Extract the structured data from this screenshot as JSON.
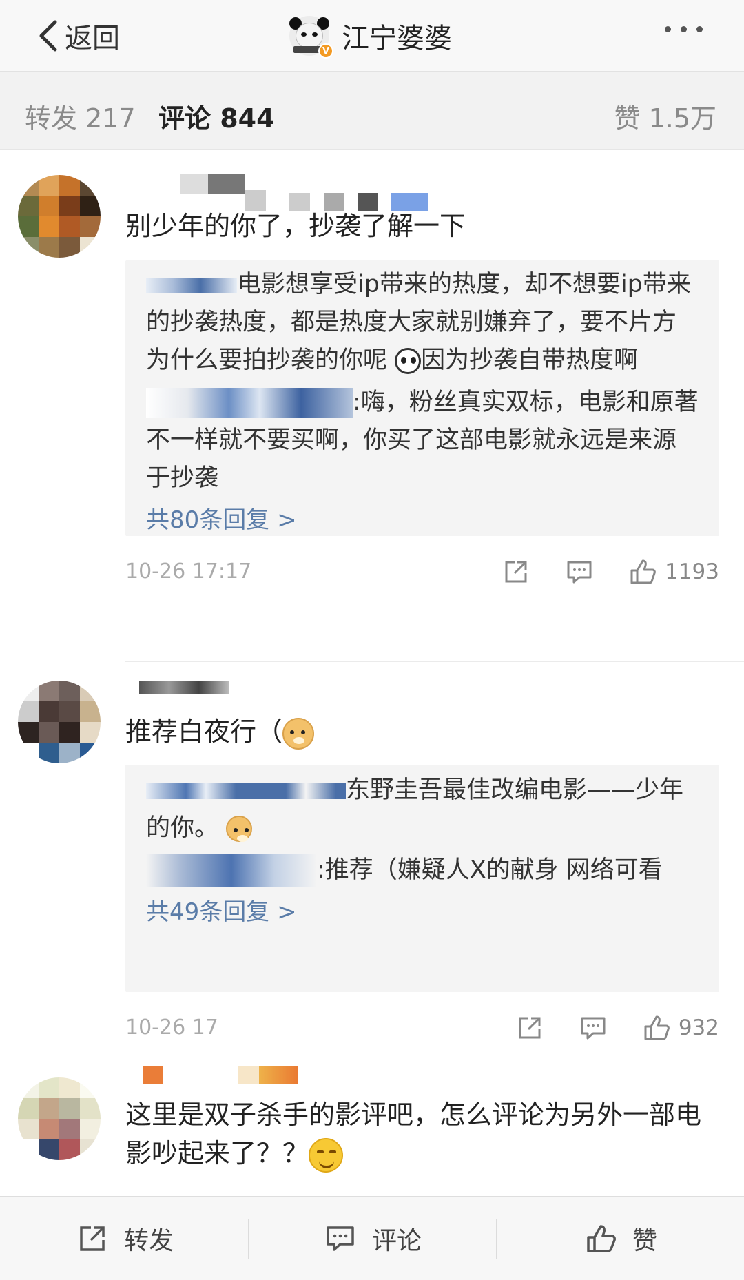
{
  "nav": {
    "back_label": "返回",
    "title": "江宁婆婆",
    "more_icon": "ellipsis-icon",
    "avatar_icon": "panda-meme-avatar",
    "verified_badge": "V"
  },
  "stats": {
    "forward": "转发 217",
    "comment": "评论 844",
    "like": "赞 1.5万"
  },
  "comments": [
    {
      "text": "别少年的你了，抄袭了解一下",
      "replies": [
        {
          "text": "电影想享受ip带来的热度，却不想要ip带来的抄袭热度，都是热度大家就别嫌弃了，要不片方为什么要拍抄袭的你呢",
          "emoji": "panda-emoji",
          "text_after": "因为抄袭自带热度啊"
        },
        {
          "text": ":嗨，粉丝真实双标，电影和原著不一样就不要买啊，你买了这部电影就永远是来源于抄袭"
        }
      ],
      "more_replies": "共80条回复 >",
      "time": "10-26 17:17",
      "likes": "1193"
    },
    {
      "text": "推荐白夜行（",
      "emoji": "doge-emoji",
      "replies": [
        {
          "text": "东野圭吾最佳改编电影——少年的你。",
          "emoji": "doge-emoji"
        },
        {
          "text": ":推荐（嫌疑人X的献身  网络可看"
        }
      ],
      "more_replies": "共49条回复 >",
      "time": "10-26 17",
      "likes": "932"
    },
    {
      "text": "这里是双子杀手的影评吧，怎么评论为另外一部电影吵起来了？？",
      "emoji": "smirk-emoji"
    }
  ],
  "toolbar": {
    "forward": "转发",
    "comment": "评论",
    "like": "赞"
  },
  "colors": {
    "link": "#5a7ca8",
    "verified": "#f39a23"
  }
}
